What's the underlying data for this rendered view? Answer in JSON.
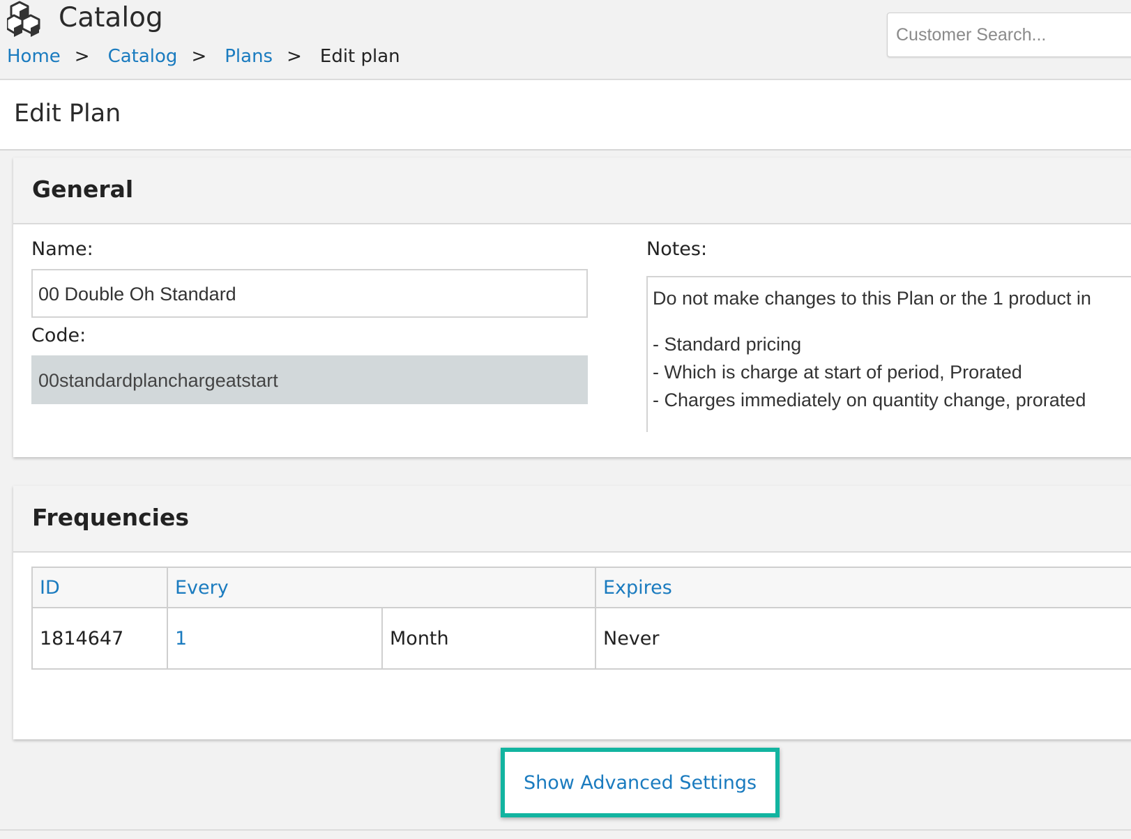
{
  "header": {
    "app_title": "Catalog",
    "logo_icon": "cubes-icon",
    "breadcrumb": [
      {
        "label": "Home"
      },
      {
        "label": "Catalog"
      },
      {
        "label": "Plans"
      },
      {
        "label": "Edit plan"
      }
    ],
    "breadcrumb_separator": ">",
    "search_placeholder": "Customer Search..."
  },
  "page": {
    "title": "Edit Plan"
  },
  "general": {
    "heading": "General",
    "name_label": "Name:",
    "name_value": "00 Double Oh Standard",
    "code_label": "Code:",
    "code_value": "00standardplanchargeatstart",
    "notes_label": "Notes:",
    "notes_lines": [
      "Do not make changes to this Plan or the 1 product in",
      "- Standard pricing",
      "- Which is charge at start of period, Prorated",
      "- Charges immediately on quantity change, prorated"
    ]
  },
  "frequencies": {
    "heading": "Frequencies",
    "columns": [
      "ID",
      "Every",
      "Expires"
    ],
    "rows": [
      {
        "id": "1814647",
        "every_count": "1",
        "every_unit": "Month",
        "expires": "Never"
      }
    ]
  },
  "advanced_button_label": "Show Advanced Settings",
  "colors": {
    "link": "#1a7bbf",
    "highlight_border": "#12b4a0",
    "readonly_field": "#d2d8da"
  }
}
